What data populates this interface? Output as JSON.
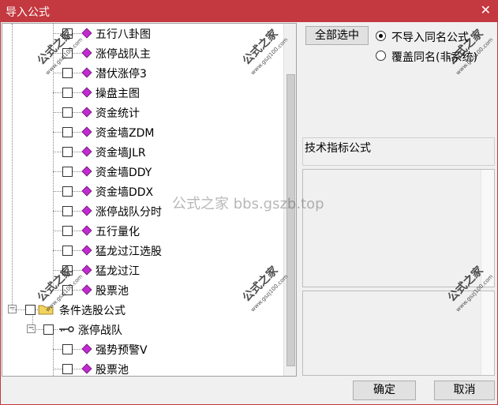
{
  "window": {
    "title": "导入公式",
    "close_glyph": "✕"
  },
  "tree": {
    "items": [
      {
        "label": "五行八卦图",
        "level": 2
      },
      {
        "label": "涨停战队主",
        "level": 2
      },
      {
        "label": "潜伏涨停3",
        "level": 2
      },
      {
        "label": "操盘主图",
        "level": 2
      },
      {
        "label": "资金统计",
        "level": 2
      },
      {
        "label": "资金墙ZDM",
        "level": 2
      },
      {
        "label": "资金墙JLR",
        "level": 2
      },
      {
        "label": "资金墙DDY",
        "level": 2
      },
      {
        "label": "资金墙DDX",
        "level": 2
      },
      {
        "label": "涨停战队分时",
        "level": 2
      },
      {
        "label": "五行量化",
        "level": 2
      },
      {
        "label": "猛龙过江选股",
        "level": 2
      },
      {
        "label": "猛龙过江",
        "level": 2
      },
      {
        "label": "股票池",
        "level": 2
      },
      {
        "label": "条件选股公式",
        "level": 0
      },
      {
        "label": "涨停战队",
        "level": 1
      },
      {
        "label": "强势预警V",
        "level": 2
      },
      {
        "label": "股票池",
        "level": 2
      }
    ]
  },
  "right_panel": {
    "select_all_label": "全部选中",
    "radio_skip_label": "不导入同名公式",
    "radio_overwrite_label": "覆盖同名(非系统)",
    "category_text": "技术指标公式"
  },
  "buttons": {
    "ok_label": "确定",
    "cancel_label": "取消"
  },
  "watermark_text": "公式之家 bbs.gszb.top",
  "stamp": {
    "big": "公式之家",
    "small": "www.gszj100.com"
  },
  "colors": {
    "titlebar": "#c4383f",
    "diamond": "#c02ad0",
    "folder": "#f2d35c"
  }
}
